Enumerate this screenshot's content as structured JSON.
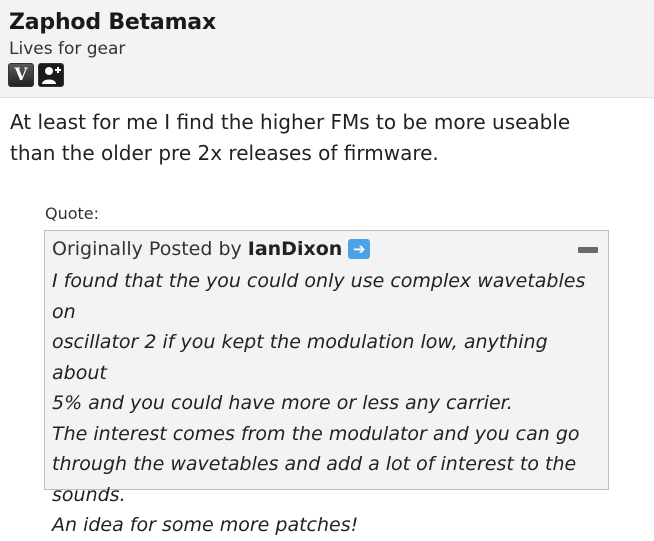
{
  "post": {
    "user": {
      "name": "Zaphod Betamax",
      "title": "Lives for gear",
      "badge_letter": "V"
    },
    "message_lines": [
      "At least for me I find the higher FMs to be more useable",
      "than the older pre 2x releases of firmware."
    ],
    "quote": {
      "label": "Quote:",
      "prefix": "Originally Posted by",
      "author": "IanDixon",
      "arrow_icon": "arrow-right-icon",
      "lines": [
        "I found that the you could only use complex wavetables on",
        "oscillator 2 if you kept the modulation low, anything about",
        "5% and you could have more or less any carrier.",
        "The interest comes from the modulator and you can go",
        "through the wavetables and add a lot of interest to the",
        "sounds.",
        "An idea for some more patches!"
      ]
    }
  },
  "colors": {
    "header_bg": "#f3f3f3",
    "quote_bg": "#f3f3f3",
    "link_arrow": "#4aa3e6"
  }
}
